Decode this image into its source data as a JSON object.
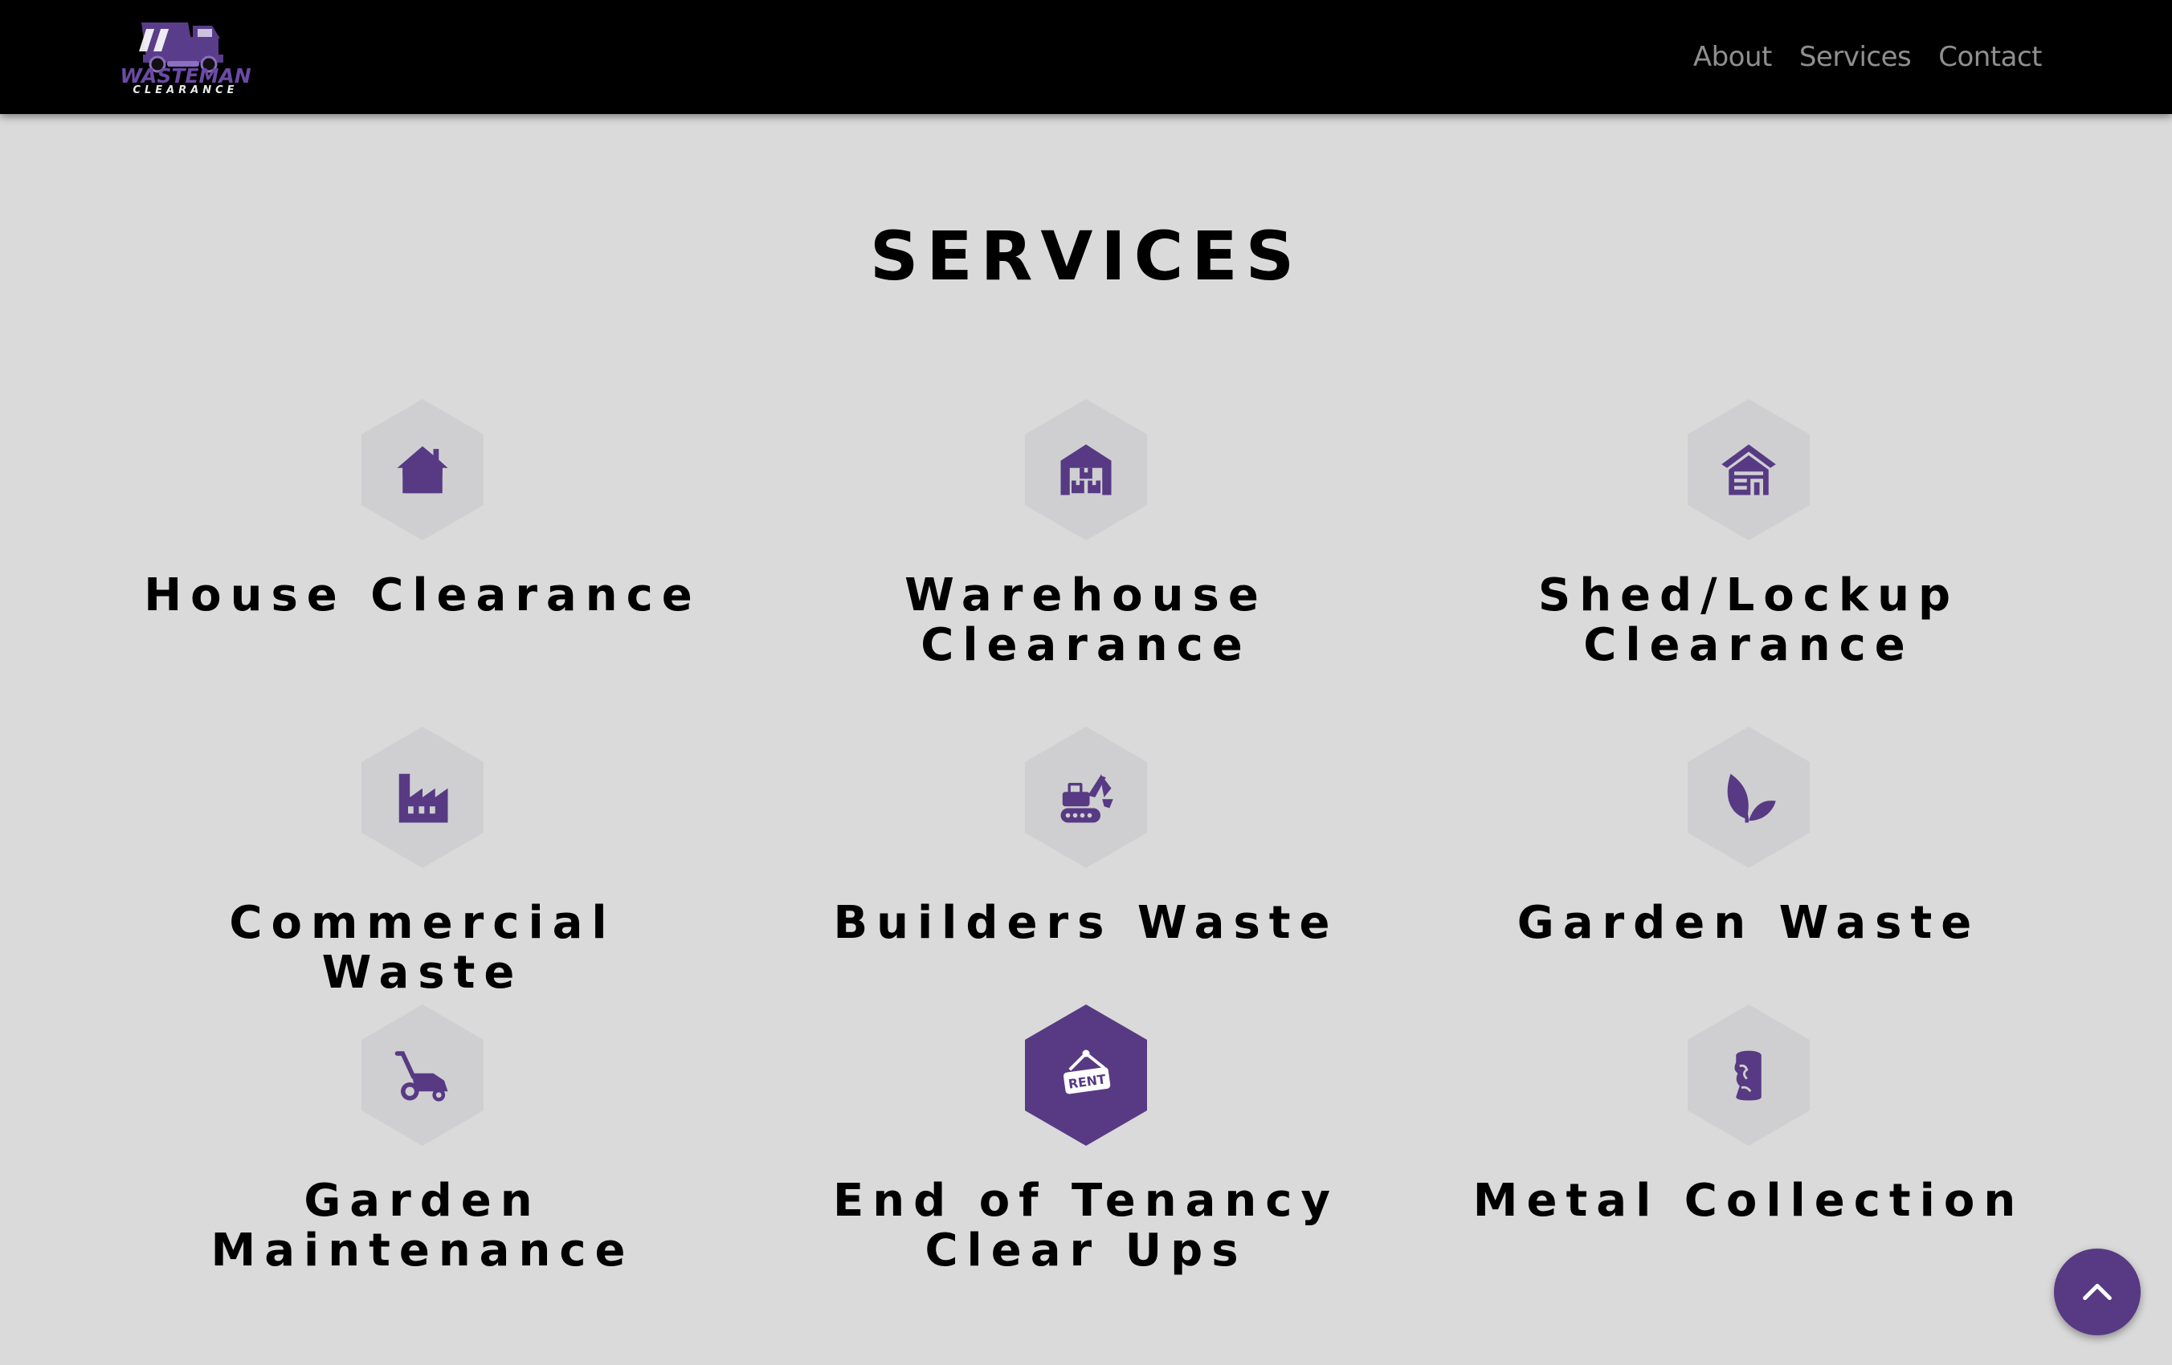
{
  "brand": {
    "logo_line1": "WASTEMAN",
    "logo_line2": "CLEARANCE",
    "logo_icon": "dump-truck-icon",
    "accent_color": "#573a83"
  },
  "nav": {
    "items": [
      {
        "label": "About"
      },
      {
        "label": "Services"
      },
      {
        "label": "Contact"
      }
    ]
  },
  "services": {
    "title": "SERVICES",
    "items": [
      {
        "label": "House Clearance",
        "icon": "house-icon"
      },
      {
        "label": "Warehouse Clearance",
        "icon": "warehouse-icon"
      },
      {
        "label": "Shed/Lockup Clearance",
        "icon": "shed-icon"
      },
      {
        "label": "Commercial Waste",
        "icon": "factory-icon"
      },
      {
        "label": "Builders Waste",
        "icon": "excavator-icon"
      },
      {
        "label": "Garden Waste",
        "icon": "leaf-icon"
      },
      {
        "label": "Garden Maintenance",
        "icon": "lawn-mower-icon"
      },
      {
        "label": "End of Tenancy Clear Ups",
        "icon": "rent-sign-icon",
        "icon_text": "RENT",
        "active": true
      },
      {
        "label": "Metal Collection",
        "icon": "metal-can-icon"
      }
    ]
  },
  "scroll_top": {
    "icon": "chevron-up-icon"
  }
}
